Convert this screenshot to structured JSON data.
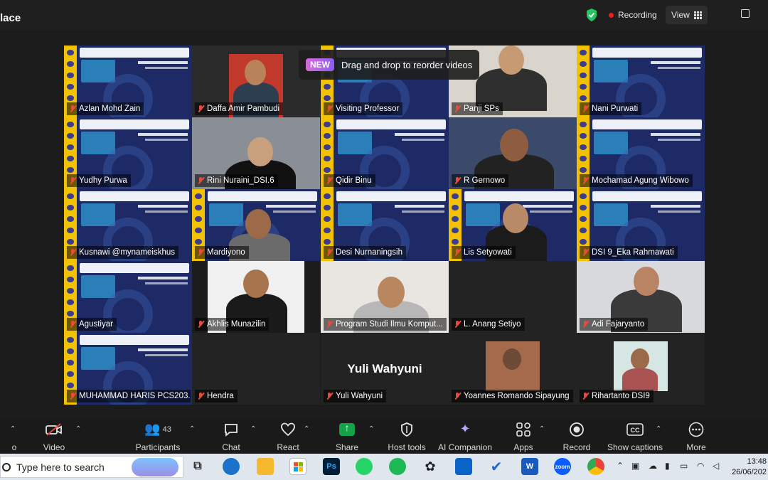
{
  "window": {
    "title_fragment": "lace"
  },
  "topbar": {
    "recording_label": "Recording",
    "view_label": "View"
  },
  "tooltip": {
    "badge": "NEW",
    "text": "Drag and drop to reorder videos"
  },
  "participants": [
    {
      "name": "Azlan Mohd Zain"
    },
    {
      "name": "Daffa Amir Pambudi"
    },
    {
      "name": "Visiting Professor"
    },
    {
      "name": "Panji SPs"
    },
    {
      "name": "Nani Purwati"
    },
    {
      "name": "Yudhy Purwa"
    },
    {
      "name": "Rini Nuraini_DSI.6"
    },
    {
      "name": "Qidir Binu"
    },
    {
      "name": "R Gernowo"
    },
    {
      "name": "Mochamad Agung Wibowo"
    },
    {
      "name": "Kusnawi @mynameiskhus"
    },
    {
      "name": "Mardiyono"
    },
    {
      "name": "Desi Nurnaningsih"
    },
    {
      "name": "Lis Setyowati"
    },
    {
      "name": "DSI 9_Eka Rahmawati"
    },
    {
      "name": "Agustiyar"
    },
    {
      "name": "Akhlis Munazilin"
    },
    {
      "name": "Program Studi Ilmu Komput..."
    },
    {
      "name": "L. Anang Setiyo"
    },
    {
      "name": "Adi Fajaryanto"
    },
    {
      "name": "MUHAMMAD HARIS PCS203..."
    },
    {
      "name": "Hendra"
    },
    {
      "name": "Yuli Wahyuni"
    },
    {
      "name": "Yoannes Romando Sipayung"
    },
    {
      "name": "Rihartanto DSI9"
    }
  ],
  "big_name": "Yuli Wahyuni",
  "toolbar": {
    "audio_partial": "o",
    "video": "Video",
    "participants": "Participants",
    "participants_count": "43",
    "chat": "Chat",
    "react": "React",
    "share": "Share",
    "host_tools": "Host tools",
    "ai_companion": "AI Companion",
    "apps": "Apps",
    "record": "Record",
    "show_captions": "Show captions",
    "more": "More"
  },
  "taskbar": {
    "search_placeholder": "Type here to search",
    "app_ps": "Ps",
    "app_zoom": "zoom",
    "time": "13:48",
    "date": "26/06/202"
  },
  "colors": {
    "accent_green": "#2ecc71",
    "record_red": "#e02424",
    "banner_blue": "#1d2a66",
    "banner_yellow": "#f2c200",
    "share_green": "#15a34a"
  }
}
